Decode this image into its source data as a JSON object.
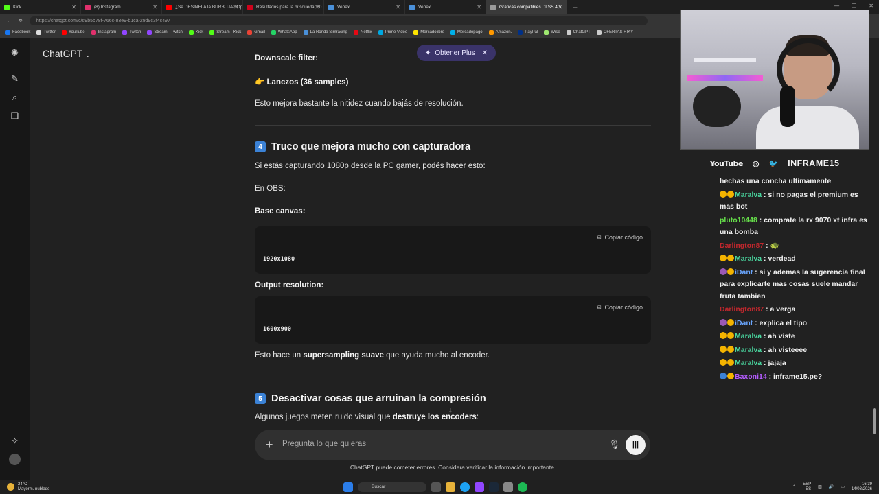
{
  "browser": {
    "tabs": [
      {
        "label": "Kick",
        "color": "#53fc18"
      },
      {
        "label": "(8) Instagram",
        "color": "#e1306c"
      },
      {
        "label": "¿Se DESINFLA la BURBUJA? Oper...",
        "color": "#ff0000"
      },
      {
        "label": "Resultados para la búsqueda: 50...",
        "color": "#d0021b"
      },
      {
        "label": "Venex",
        "color": "#4a90d9"
      },
      {
        "label": "Venex",
        "color": "#4a90d9"
      },
      {
        "label": "Graficas compatibles DLSS 4.5",
        "color": "#9b9b9b"
      }
    ],
    "url": "https://chatgpt.com/c/69b5b78f-766c-83e9-b1ca-29d9c3f4c497",
    "bookmarks": [
      {
        "label": "Facebook",
        "color": "#1877f2"
      },
      {
        "label": "Twitter",
        "color": "#dddddd"
      },
      {
        "label": "YouTube",
        "color": "#ff0000"
      },
      {
        "label": "Instagram",
        "color": "#e1306c"
      },
      {
        "label": "Twitch",
        "color": "#9146ff"
      },
      {
        "label": "Stream - Twitch",
        "color": "#9146ff"
      },
      {
        "label": "Kick",
        "color": "#53fc18"
      },
      {
        "label": "Stream - Kick",
        "color": "#53fc18"
      },
      {
        "label": "Gmail",
        "color": "#ea4335"
      },
      {
        "label": "WhatsApp",
        "color": "#25d366"
      },
      {
        "label": "La Ronda Simracing",
        "color": "#4a90d9"
      },
      {
        "label": "Netflix",
        "color": "#e50914"
      },
      {
        "label": "Prime Video",
        "color": "#00a8e1"
      },
      {
        "label": "Mercadolibre",
        "color": "#ffe600"
      },
      {
        "label": "Mercadopago",
        "color": "#00b1ea"
      },
      {
        "label": "Amazon.",
        "color": "#ff9900"
      },
      {
        "label": "PayPal",
        "color": "#003087"
      },
      {
        "label": "Wise",
        "color": "#9fe870"
      },
      {
        "label": "ChatGPT",
        "color": "#cccccc"
      },
      {
        "label": "OFERTAS RIKY",
        "color": "#cccccc"
      }
    ]
  },
  "chatgpt": {
    "model_label": "ChatGPT",
    "upgrade_label": "Obtener Plus",
    "downscale_label": "Downscale filter:",
    "lanczos_emoji": "👉",
    "lanczos_label": "Lanczos (36 samples)",
    "downscale_note": "Esto mejora bastante la nitidez cuando bajás de resolución.",
    "section4": {
      "num": "4",
      "title": "Truco que mejora mucho con capturadora"
    },
    "capture_intro": "Si estás capturando 1080p desde la PC gamer, podés hacer esto:",
    "obs_label": "En OBS:",
    "base_canvas_label": "Base canvas:",
    "copy_label": "Copiar código",
    "base_canvas_value": "1920x1080",
    "output_res_label": "Output resolution:",
    "output_res_value": "1600x900",
    "supersampling_pre": "Esto hace un ",
    "supersampling_bold": "supersampling suave",
    "supersampling_post": " que ayuda mucho al encoder.",
    "section5": {
      "num": "5",
      "title": "Desactivar cosas que arruinan la compresión"
    },
    "games_pre": "Algunos juegos meten ruido visual que ",
    "games_bold": "destruye los encoders",
    "games_post": ":",
    "composer_placeholder": "Pregunta lo que quieras",
    "disclaimer": "ChatGPT puede cometer errores. Considera verificar la información importante."
  },
  "stream": {
    "youtube_label": "YouTube",
    "channel_name": "INFRAME15",
    "chat": [
      {
        "user": "",
        "user_color": "#efefef",
        "badges": [],
        "text": "hechas una concha ultimamente"
      },
      {
        "user": "Maralva",
        "user_color": "#4ad8a0",
        "badges": [
          "#f4b400",
          "#f4b400"
        ],
        "text": ": si no pagas el premium es mas bot"
      },
      {
        "user": "pluto10448",
        "user_color": "#66e04a",
        "badges": [],
        "text": ": comprate la rx 9070 xt infra es una bomba"
      },
      {
        "user": "Darlington87",
        "user_color": "#c0272d",
        "badges": [],
        "text": ": 🐢"
      },
      {
        "user": "Maralva",
        "user_color": "#4ad8a0",
        "badges": [
          "#f4b400",
          "#f4b400"
        ],
        "text": ": verdead"
      },
      {
        "user": "iDant",
        "user_color": "#6aa6ff",
        "badges": [
          "#9b59b6",
          "#f4b400"
        ],
        "text": ": si y ademas la sugerencia final para explicarte mas cosas suele mandar fruta tambien"
      },
      {
        "user": "Darlington87",
        "user_color": "#c0272d",
        "badges": [],
        "text": ": a verga"
      },
      {
        "user": "iDant",
        "user_color": "#6aa6ff",
        "badges": [
          "#9b59b6",
          "#f4b400"
        ],
        "text": ": explica el tipo"
      },
      {
        "user": "Maralva",
        "user_color": "#4ad8a0",
        "badges": [
          "#f4b400",
          "#f4b400"
        ],
        "text": ": ah viste"
      },
      {
        "user": "Maralva",
        "user_color": "#4ad8a0",
        "badges": [
          "#f4b400",
          "#f4b400"
        ],
        "text": ": ah visteeee"
      },
      {
        "user": "Maralva",
        "user_color": "#4ad8a0",
        "badges": [
          "#f4b400",
          "#f4b400"
        ],
        "text": ": jajaja"
      },
      {
        "user": "Baxoni14",
        "user_color": "#b45cff",
        "badges": [
          "#3b82d6",
          "#f4b400"
        ],
        "text": ": inframe15.pe?"
      }
    ]
  },
  "taskbar": {
    "temp": "24°C",
    "weather": "Mayorm. nublado",
    "search_label": "Buscar",
    "lang_top": "ESP",
    "lang_bottom": "ES",
    "time": "16:39",
    "date": "14/03/2026"
  }
}
